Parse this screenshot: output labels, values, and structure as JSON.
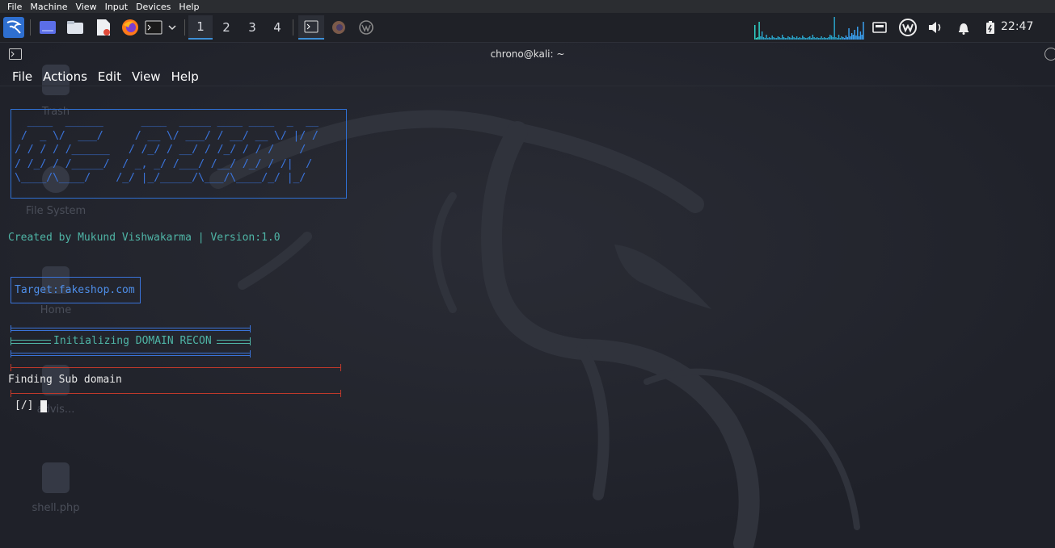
{
  "vm_menu": [
    "File",
    "Machine",
    "View",
    "Input",
    "Devices",
    "Help"
  ],
  "panel": {
    "workspaces": [
      "1",
      "2",
      "3",
      "4"
    ],
    "active_workspace": "1",
    "clock": "22:47",
    "accent": "#3d8fd6"
  },
  "desktop_icons": [
    "Trash",
    "File System",
    "Home",
    "advis...",
    "shell.php"
  ],
  "terminal": {
    "title": "chrono@kali: ~",
    "menu": [
      "File",
      "Actions",
      "Edit",
      "View",
      "Help"
    ],
    "banner_art": "  ____  ______      ____  _____ ____ ____  _  __\n /  _ \\/  ___/     / __ \\/ ___/ / __/ __ \\/ |/ /\n/ / / / /______   / /_/ / __/ / /_/ / / /    /\n/ /_/ / /_____/  / _, _/ /___/ /__/ /_/ / /|  /\n\\____/\\____/    /_/ |_/_____/\\___/\\____/_/ |_/",
    "creator_line": "Created by Mukund Vishwakarma | Version:1.0",
    "target": "Target:fakeshop.com",
    "init_line": "Initializing DOMAIN RECON",
    "finding_line": "Finding Sub domain",
    "prompt": "[/]"
  },
  "colors": {
    "banner_blue": "#3a73d9",
    "teal": "#4fb5a6",
    "red_rule": "#c0392b"
  }
}
